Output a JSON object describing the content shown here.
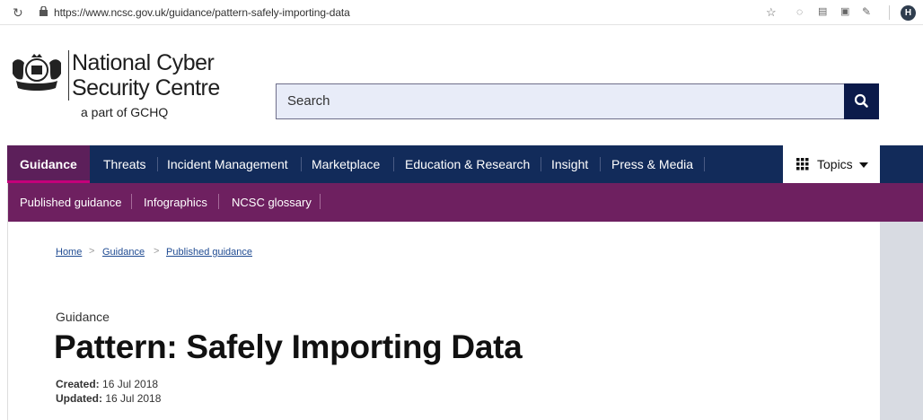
{
  "browser": {
    "reload_icon": "reload-icon",
    "url": "https://www.ncsc.gov.uk/guidance/pattern-safely-importing-data",
    "avatar_letter": "H"
  },
  "header": {
    "brand_line1": "National Cyber",
    "brand_line2": "Security Centre",
    "brand_line3": "a part of GCHQ",
    "search_placeholder": "Search"
  },
  "main_nav": {
    "items": [
      "Guidance",
      "Threats",
      "Incident Management",
      "Marketplace",
      "Education & Research",
      "Insight",
      "Press & Media"
    ],
    "active": "Guidance",
    "topics_label": "Topics"
  },
  "sub_nav": {
    "items": [
      "Published guidance",
      "Infographics",
      "NCSC glossary"
    ]
  },
  "breadcrumb": [
    "Home",
    "Guidance",
    "Published guidance"
  ],
  "article": {
    "kicker": "Guidance",
    "title": "Pattern: Safely Importing Data",
    "created_label": "Created:",
    "created_value": "16 Jul 2018",
    "updated_label": "Updated:",
    "updated_value": "16 Jul 2018"
  },
  "colors": {
    "nav_bg": "#122b5a",
    "nav_active_bg": "#5c1f5a",
    "subnav_bg": "#6e2060",
    "search_bg": "#e8ecf8",
    "search_btn_bg": "#0b1a4a",
    "link": "#1f4b92"
  }
}
